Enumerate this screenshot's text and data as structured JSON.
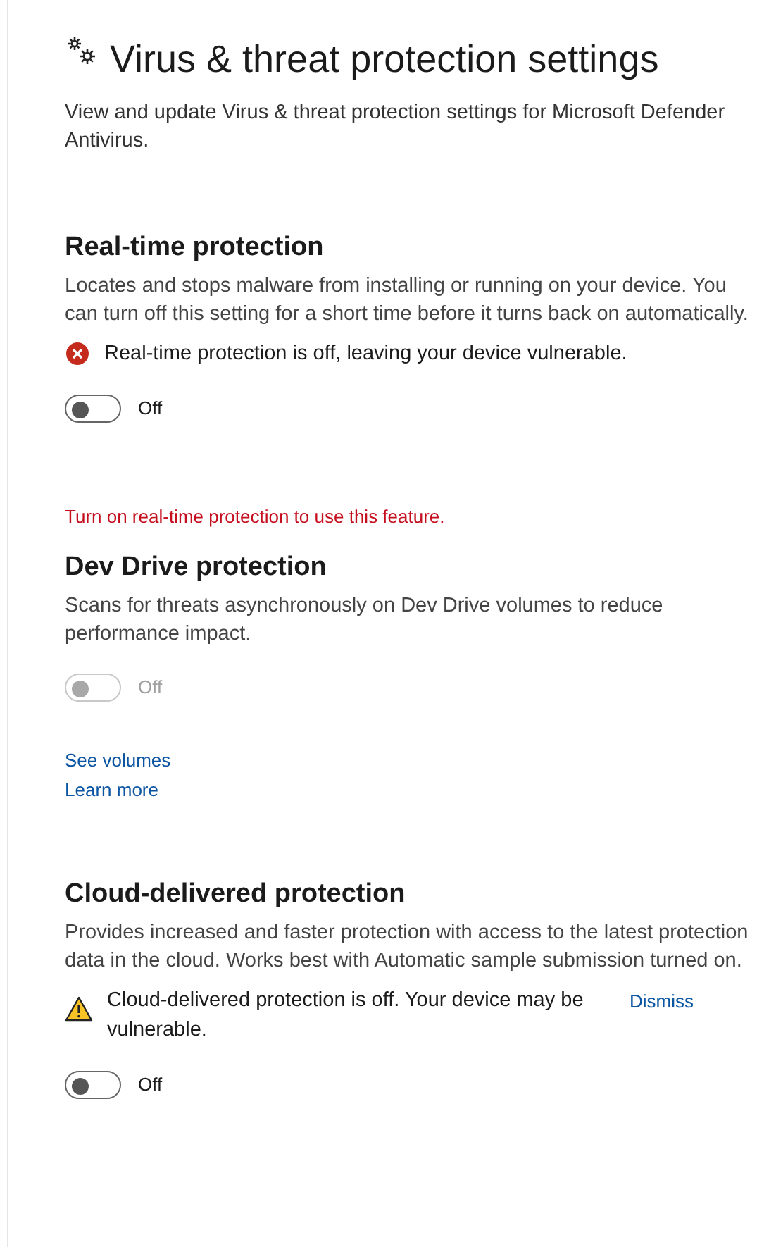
{
  "page": {
    "title": "Virus & threat protection settings",
    "description": "View and update Virus & threat protection settings for Microsoft Defender Antivirus."
  },
  "sections": [
    {
      "title": "Real-time protection",
      "description": "Locates and stops malware from installing or running on your device. You can turn off this setting for a short time before it turns back on automatically.",
      "alert": {
        "kind": "error",
        "text": "Real-time protection is off, leaving your device vulnerable."
      },
      "toggle": {
        "on": false,
        "disabled": false,
        "label": "Off"
      }
    },
    {
      "notice": "Turn on real-time protection to use this feature.",
      "title": "Dev Drive protection",
      "description": "Scans for threats asynchronously on Dev Drive volumes to reduce performance impact.",
      "toggle": {
        "on": false,
        "disabled": true,
        "label": "Off"
      },
      "links": [
        "See volumes",
        "Learn more"
      ]
    },
    {
      "title": "Cloud-delivered protection",
      "description": "Provides increased and faster protection with access to the latest protection data in the cloud. Works best with Automatic sample submission turned on.",
      "alert": {
        "kind": "warning",
        "text": "Cloud-delivered protection is off. Your device may be vulnerable.",
        "action": "Dismiss"
      },
      "toggle": {
        "on": false,
        "disabled": false,
        "label": "Off"
      }
    }
  ]
}
